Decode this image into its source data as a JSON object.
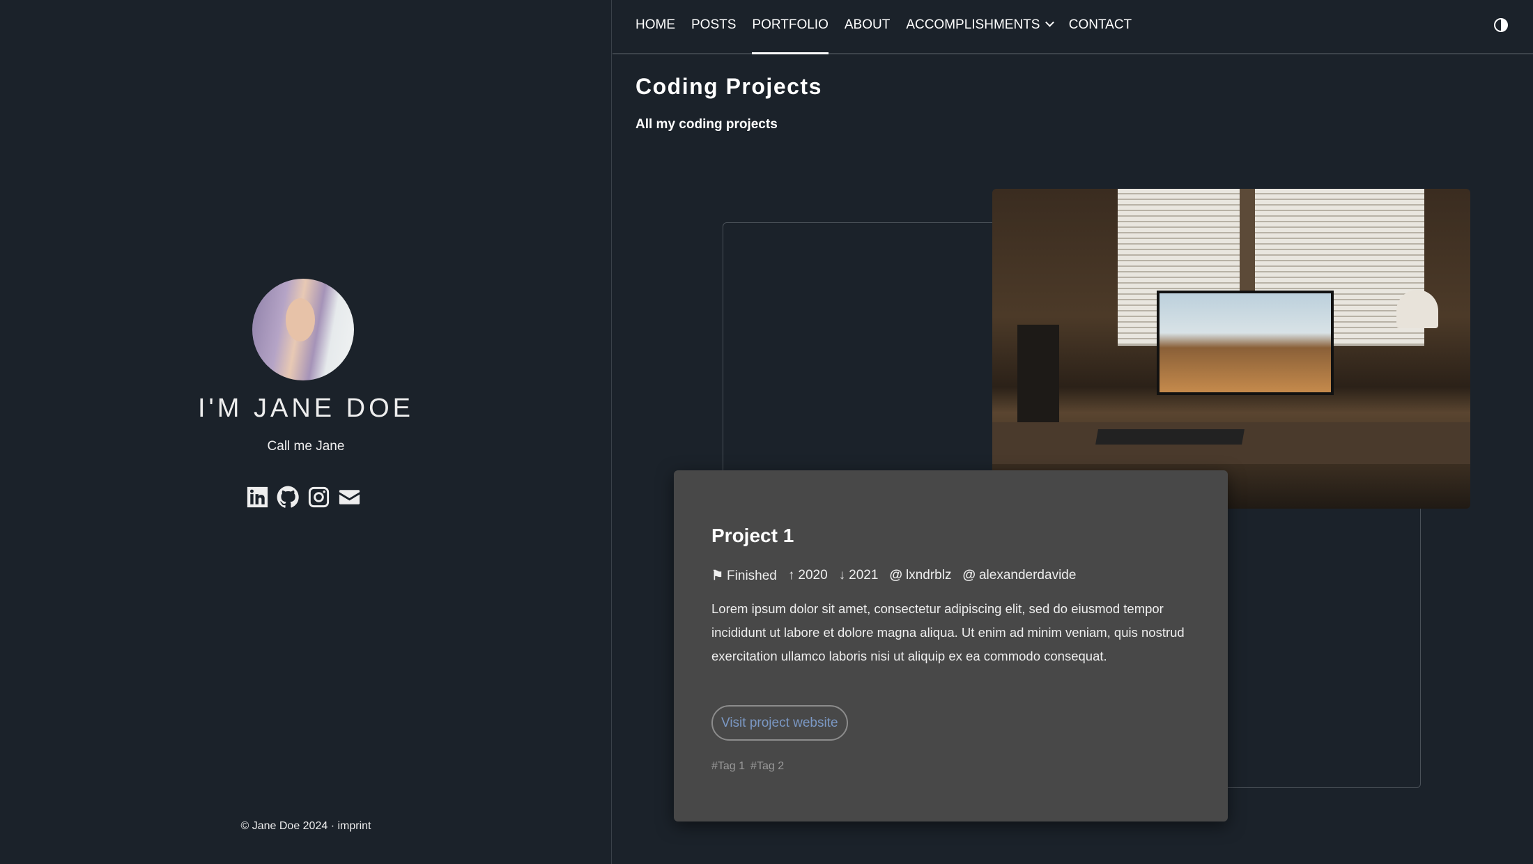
{
  "sidebar": {
    "name": "I'M JANE DOE",
    "tagline": "Call me Jane",
    "social": [
      "linkedin",
      "github",
      "instagram",
      "email"
    ],
    "footer": {
      "copyright": "© Jane Doe 2024",
      "sep": "·",
      "imprint": "imprint"
    }
  },
  "nav": {
    "items": [
      "HOME",
      "POSTS",
      "PORTFOLIO",
      "ABOUT",
      "ACCOMPLISHMENTS",
      "CONTACT"
    ],
    "active": "PORTFOLIO"
  },
  "page": {
    "title": "Coding Projects",
    "subtitle": "All my coding projects"
  },
  "project": {
    "title": "Project 1",
    "status": "Finished",
    "start": "2020",
    "end": "2021",
    "authors": [
      "lxndrblz",
      "alexanderdavide"
    ],
    "description": "Lorem ipsum dolor sit amet, consectetur adipiscing elit, sed do eiusmod tempor incididunt ut labore et dolore magna aliqua. Ut enim ad minim veniam, quis nostrud exercitation ullamco laboris nisi ut aliquip ex ea commodo consequat.",
    "button": "Visit project website",
    "tags": [
      "#Tag 1",
      "#Tag 2"
    ]
  },
  "colors": {
    "bg": "#1b222a",
    "card": "#484848",
    "link": "#7b98c4"
  }
}
